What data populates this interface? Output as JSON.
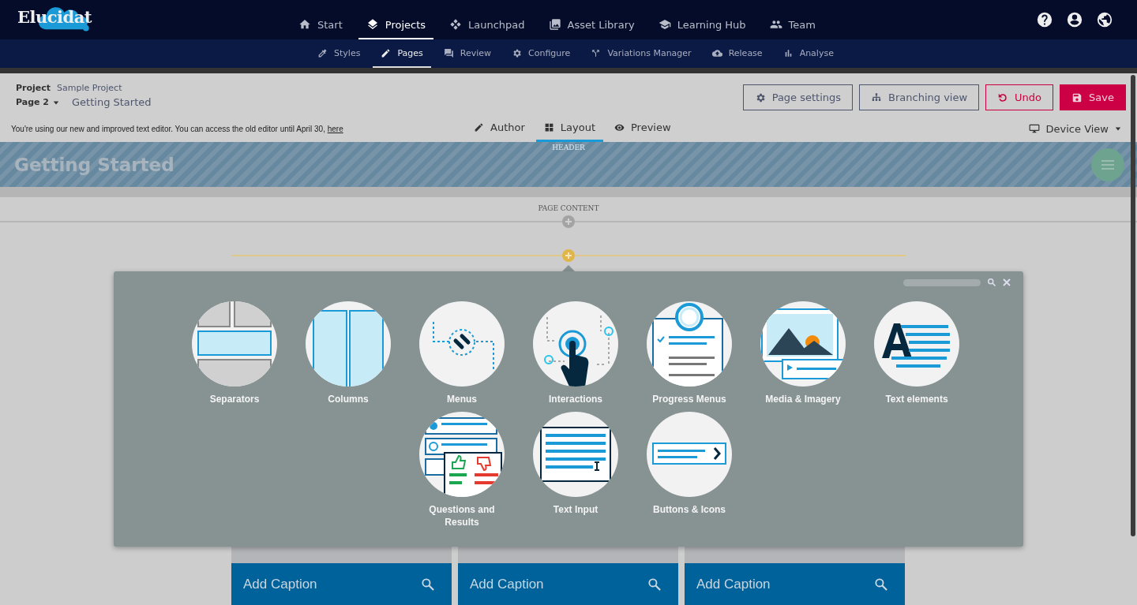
{
  "top_nav": {
    "logo": "Elucidat",
    "items": [
      {
        "label": "Start",
        "kind": "home",
        "selected": false
      },
      {
        "label": "Projects",
        "kind": "layers",
        "selected": true
      },
      {
        "label": "Launchpad",
        "kind": "diamonds",
        "selected": false
      },
      {
        "label": "Asset Library",
        "kind": "images",
        "selected": false
      },
      {
        "label": "Learning Hub",
        "kind": "cap",
        "selected": false
      },
      {
        "label": "Team",
        "kind": "people",
        "selected": false
      }
    ],
    "utility_icons": [
      {
        "kind": "help"
      },
      {
        "kind": "account"
      },
      {
        "kind": "globe"
      }
    ]
  },
  "sub_nav": {
    "items": [
      {
        "label": "Styles",
        "kind": "dropper",
        "selected": false
      },
      {
        "label": "Pages",
        "kind": "pencil",
        "selected": true
      },
      {
        "label": "Review",
        "kind": "chat",
        "selected": false
      },
      {
        "label": "Configure",
        "kind": "gear",
        "selected": false
      },
      {
        "label": "Variations Manager",
        "kind": "fork",
        "selected": false
      },
      {
        "label": "Release",
        "kind": "cloud",
        "selected": false
      },
      {
        "label": "Analyse",
        "kind": "bars",
        "selected": false
      }
    ]
  },
  "project_bar": {
    "project_label": "Project",
    "project_name": "Sample Project",
    "page_selector": "Page 2",
    "page_title": "Getting Started",
    "buttons": [
      {
        "label": "Page settings",
        "kind": "settings"
      },
      {
        "label": "Branching view",
        "kind": "branching"
      },
      {
        "label": "Undo",
        "kind": "undo"
      },
      {
        "label": "Save",
        "kind": "save"
      }
    ]
  },
  "notice": {
    "text": "You're using our new and improved text editor. You can access the old editor until April 30,",
    "link": "here"
  },
  "mode_tabs": [
    {
      "label": "Author",
      "kind": "pencil",
      "selected": false
    },
    {
      "label": "Layout",
      "kind": "grid",
      "selected": true
    },
    {
      "label": "Preview",
      "kind": "eye",
      "selected": false
    }
  ],
  "device_view": "Device View",
  "canvas": {
    "header_label": "HEADER",
    "page_title": "Getting Started",
    "content_label": "PAGE CONTENT"
  },
  "element_picker": {
    "items": [
      {
        "label": "Separators",
        "kind": "separators"
      },
      {
        "label": "Columns",
        "kind": "columns"
      },
      {
        "label": "Menus",
        "kind": "menus"
      },
      {
        "label": "Interactions",
        "kind": "interactions"
      },
      {
        "label": "Progress Menus",
        "kind": "progress"
      },
      {
        "label": "Media & Imagery",
        "kind": "media"
      },
      {
        "label": "Text elements",
        "kind": "text"
      },
      {
        "label": "Questions and Results",
        "kind": "questions"
      },
      {
        "label": "Text Input",
        "kind": "input"
      },
      {
        "label": "Buttons & Icons",
        "kind": "buttons"
      }
    ]
  },
  "captions": [
    "Add Caption",
    "Add Caption",
    "Add Caption"
  ]
}
